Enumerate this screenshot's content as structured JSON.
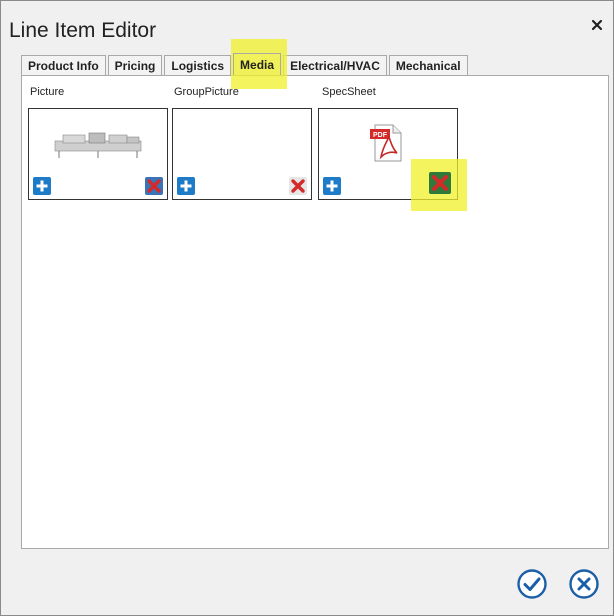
{
  "window": {
    "title": "Line Item Editor",
    "close_icon": "close-icon"
  },
  "tabs": [
    {
      "label": "Product Info",
      "active": false
    },
    {
      "label": "Pricing",
      "active": false
    },
    {
      "label": "Logistics",
      "active": false
    },
    {
      "label": "Media",
      "active": true
    },
    {
      "label": "Electrical/HVAC",
      "active": false
    },
    {
      "label": "Mechanical",
      "active": false
    }
  ],
  "media": {
    "slots": [
      {
        "label": "Picture",
        "content_icon": "equipment-image",
        "add_icon": "plus-icon",
        "delete_icon": "delete-x-icon"
      },
      {
        "label": "GroupPicture",
        "content_icon": "",
        "add_icon": "plus-icon",
        "delete_icon": "delete-x-icon"
      },
      {
        "label": "SpecSheet",
        "content_icon": "pdf-file-icon",
        "add_icon": "plus-icon",
        "delete_icon": "delete-x-icon",
        "pdf_badge": "PDF"
      }
    ]
  },
  "footer": {
    "ok_icon": "checkmark-icon",
    "cancel_icon": "cancel-icon"
  },
  "colors": {
    "highlight": "#f0f028",
    "add_button": "#1e7bc8",
    "delete_red": "#d42a2a",
    "delete_bg_selected": "#2d7a3a",
    "footer_button": "#1a5fa8"
  }
}
